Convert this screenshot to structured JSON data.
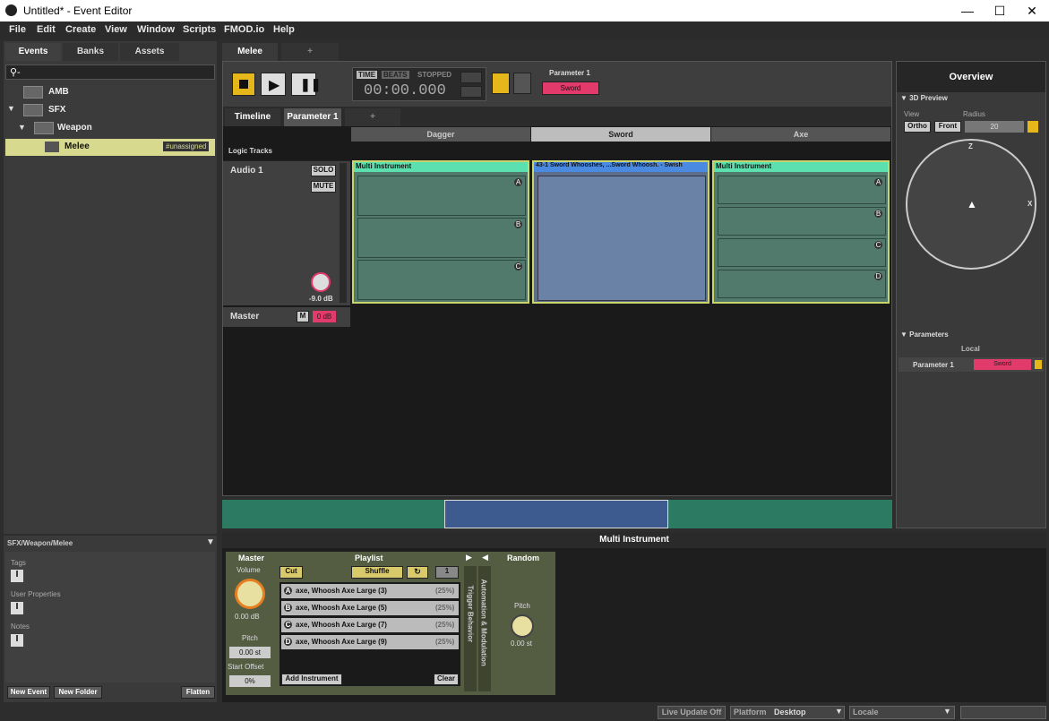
{
  "window": {
    "title": "Untitled* - Event Editor"
  },
  "menu": [
    "File",
    "Edit",
    "Create",
    "View",
    "Window",
    "Scripts",
    "FMOD.io",
    "Help"
  ],
  "left_tabs": [
    "Events",
    "Banks",
    "Assets"
  ],
  "tree": [
    {
      "label": "AMB"
    },
    {
      "label": "SFX"
    },
    {
      "label": "Weapon"
    },
    {
      "label": "Melee",
      "tag": "#unassigned"
    }
  ],
  "left_bottom": {
    "path": "SFX/Weapon/Melee",
    "sections": [
      "Tags",
      "User Properties",
      "Notes"
    ],
    "buttons": [
      "New Event",
      "New Folder",
      "Flatten"
    ]
  },
  "event_tabs": [
    "Melee",
    "+"
  ],
  "transport": {
    "time_label": "TIME",
    "beats_label": "BEATS",
    "status": "STOPPED",
    "time": "00:00.000",
    "param_label": "Parameter 1",
    "param_value": "Sword"
  },
  "sheet_tabs": [
    "Timeline",
    "Parameter 1",
    "+"
  ],
  "columns": [
    "Dagger",
    "Sword",
    "Axe"
  ],
  "logic_tracks": "Logic Tracks",
  "tracks": [
    {
      "name": "Audio 1",
      "solo": "SOLO",
      "mute": "MUTE",
      "vol": "-9.0 dB"
    },
    {
      "name": "Master",
      "m": "M",
      "vol": "0 dB"
    }
  ],
  "instruments": [
    {
      "title": "Multi Instrument",
      "badges": [
        "A",
        "B",
        "C"
      ]
    },
    {
      "title": "43-1 Sword Whooshes, ...Sword Whoosh. - Swish"
    },
    {
      "title": "Multi Instrument",
      "badges": [
        "A",
        "B",
        "C",
        "D"
      ]
    }
  ],
  "overview": {
    "title": "Overview",
    "preview": "3D Preview",
    "view_label": "View",
    "radius_label": "Radius",
    "ortho": "Ortho",
    "front": "Front",
    "radius": "20",
    "axis_z": "Z",
    "axis_x": "X",
    "params_header": "Parameters",
    "local": "Local",
    "param_name": "Parameter 1",
    "param_value": "Sword"
  },
  "deck": {
    "title": "Multi Instrument",
    "master": "Master",
    "volume_label": "Volume",
    "volume": "0.00 dB",
    "pitch_label": "Pitch",
    "pitch": "0.00 st",
    "start_label": "Start Offset",
    "start": "0%",
    "playlist": "Playlist",
    "cut": "Cut",
    "shuffle": "Shuffle",
    "loop_count": "1",
    "items": [
      {
        "badge": "A",
        "name": "axe, Whoosh Axe Large (3)",
        "pct": "(25%)"
      },
      {
        "badge": "B",
        "name": "axe, Whoosh Axe Large (5)",
        "pct": "(25%)"
      },
      {
        "badge": "C",
        "name": "axe, Whoosh Axe Large (7)",
        "pct": "(25%)"
      },
      {
        "badge": "D",
        "name": "axe, Whoosh Axe Large (9)",
        "pct": "(25%)"
      }
    ],
    "add": "Add Instrument",
    "clear": "Clear",
    "trigger": "Trigger Behavior",
    "automation": "Automation & Modulation",
    "random": "Random",
    "rand_pitch_label": "Pitch",
    "rand_pitch": "0.00 st"
  },
  "statusbar": {
    "live": "Live Update Off",
    "platform_label": "Platform",
    "platform": "Desktop",
    "locale_label": "Locale"
  }
}
